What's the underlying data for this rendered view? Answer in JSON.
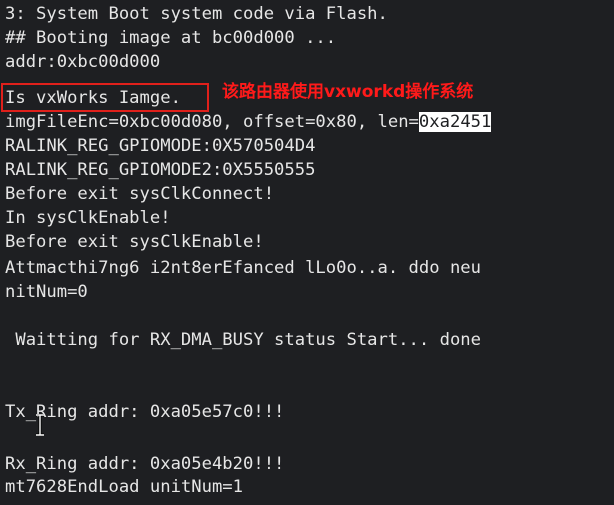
{
  "terminal": {
    "lines": [
      "3: System Boot system code via Flash.",
      "## Booting image at bc00d000 ...",
      "addr:0xbc00d000",
      "Is vxWorks Iamge.",
      "imgFileEnc=0xbc00d080, offset=0x80, len=",
      "RALINK_REG_GPIOMODE:0X570504D4",
      "RALINK_REG_GPIOMODE2:0X5550555",
      "Before exit sysClkConnect!",
      "In sysClkEnable!",
      "Before exit sysClkEnable!",
      "Attmacthi7ng6 i2nt8erEfanced lLo0o..a. ddo neu",
      "nitNum=0",
      " Waitting for RX_DMA_BUSY status Start... done",
      "Tx_Ring addr: 0xa05e57c0!!!",
      "Rx_Ring addr: 0xa05e4b20!!!",
      "mt7628EndLoad unitNum=1"
    ],
    "selected_text": "0xa2451"
  },
  "annotation": {
    "text": "该路由器使用vxworkd操作系统",
    "color": "#ff1a1a"
  },
  "colors": {
    "background": "#1e1f22",
    "foreground": "#e6e6e6",
    "highlight_border": "#e0201b"
  },
  "icons": {
    "cursor": "i-beam-cursor-icon"
  }
}
